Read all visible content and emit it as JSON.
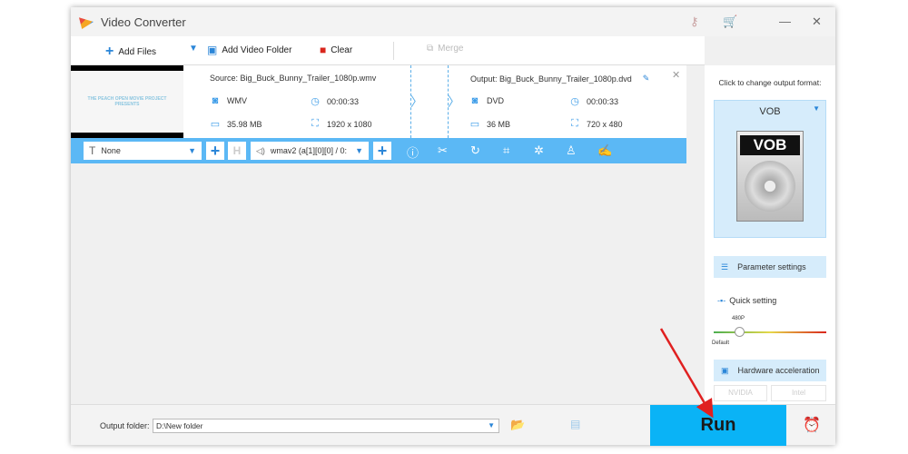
{
  "window": {
    "title": "Video Converter"
  },
  "toolbar": {
    "add_files": "Add Files",
    "add_folder": "Add Video Folder",
    "clear": "Clear",
    "merge": "Merge"
  },
  "item": {
    "thumb_text": "THE PEACH OPEN MOVIE PROJECT PRESENTS",
    "source": {
      "name": "Source: Big_Buck_Bunny_Trailer_1080p.wmv",
      "format": "WMV",
      "duration": "00:00:33",
      "size": "35.98 MB",
      "resolution": "1920 x 1080"
    },
    "output": {
      "name": "Output: Big_Buck_Bunny_Trailer_1080p.dvd",
      "format": "DVD",
      "duration": "00:00:33",
      "size": "36 MB",
      "resolution": "720 x 480"
    }
  },
  "editbar": {
    "subtitle": "None",
    "audio": "wmav2 (a[1][0][0] / 0:"
  },
  "right_panel": {
    "hint": "Click to change output format:",
    "format": "VOB",
    "format_icon_label": "VOB",
    "param_settings": "Parameter settings",
    "quick_setting": "Quick setting",
    "slider_value": "480P",
    "slider_default": "Default",
    "hw_accel": "Hardware acceleration",
    "nvidia": "NVIDIA",
    "intel": "Intel"
  },
  "bottom": {
    "output_label": "Output folder:",
    "output_path": "D:\\New folder",
    "run": "Run"
  },
  "colors": {
    "accent": "#0ab3f6",
    "edit_bar": "#5bb8f5",
    "arrow": "#e02020"
  }
}
